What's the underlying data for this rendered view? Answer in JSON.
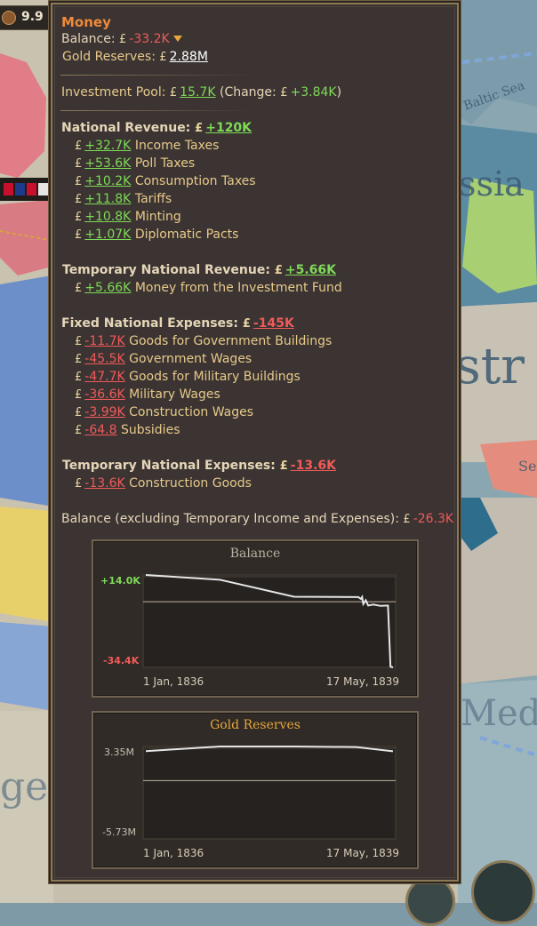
{
  "hud": {
    "value": "9.9"
  },
  "map_labels": {
    "sea": "Baltic Sea",
    "russia": "ssia",
    "austria": "str",
    "med": "Medi",
    "ser": "Se",
    "ger": "gel"
  },
  "tooltip": {
    "title": "Money",
    "balance": {
      "label": "Balance:",
      "value": "-33.2K"
    },
    "gold": {
      "label": "Gold Reserves:",
      "value": "2.88M"
    },
    "investment": {
      "label": "Investment Pool:",
      "value": "15.7K",
      "change_label": "(Change:",
      "change_value": "+3.84K",
      "close": ")"
    },
    "revenue": {
      "label": "National Revenue:",
      "value": "+120K",
      "items": [
        {
          "value": "+32.7K",
          "label": "Income Taxes"
        },
        {
          "value": "+53.6K",
          "label": "Poll Taxes"
        },
        {
          "value": "+10.2K",
          "label": "Consumption Taxes"
        },
        {
          "value": "+11.8K",
          "label": "Tariffs"
        },
        {
          "value": "+10.8K",
          "label": "Minting"
        },
        {
          "value": "+1.07K",
          "label": "Diplomatic Pacts"
        }
      ]
    },
    "temp_revenue": {
      "label": "Temporary National Revenue:",
      "value": "+5.66K",
      "items": [
        {
          "value": "+5.66K",
          "label": "Money from the Investment Fund"
        }
      ]
    },
    "fixed_expenses": {
      "label": "Fixed National Expenses:",
      "value": "-145K",
      "items": [
        {
          "value": "-11.7K",
          "label": "Goods for Government Buildings"
        },
        {
          "value": "-45.5K",
          "label": "Government Wages"
        },
        {
          "value": "-47.7K",
          "label": "Goods for Military Buildings"
        },
        {
          "value": "-36.6K",
          "label": "Military Wages"
        },
        {
          "value": "-3.99K",
          "label": "Construction Wages"
        },
        {
          "value": "-64.8",
          "label": "Subsidies"
        }
      ]
    },
    "temp_expenses": {
      "label": "Temporary National Expenses:",
      "value": "-13.6K",
      "items": [
        {
          "value": "-13.6K",
          "label": "Construction Goods"
        }
      ]
    },
    "balance_excl": {
      "label": "Balance (excluding Temporary Income and Expenses):",
      "value": "-26.3K"
    },
    "currency_symbol": "£"
  },
  "chart_data": [
    {
      "type": "line",
      "title": "Balance",
      "ylim": [
        -34.4,
        14.0
      ],
      "ytick_labels": [
        "+14.0K",
        "-34.4K"
      ],
      "xtick_labels": [
        "1 Jan, 1836",
        "17 May, 1839"
      ],
      "zero_line": true,
      "x": [
        0,
        0.3,
        0.6,
        0.86,
        0.87,
        0.875,
        0.88,
        0.89,
        0.9,
        0.92,
        0.95,
        0.98,
        0.99,
        1.0
      ],
      "values": [
        14.0,
        11.5,
        2.6,
        2.4,
        1.5,
        2.5,
        -1.2,
        0.8,
        -2.0,
        -1.5,
        -2.2,
        -2.0,
        -34.0,
        -34.4
      ],
      "colors": {
        "line": "#e6e6e6",
        "positive": "#7ed957",
        "negative": "#f05a5a"
      }
    },
    {
      "type": "line",
      "title": "Gold Reserves",
      "ylim": [
        -5.73,
        3.35
      ],
      "ytick_labels": [
        "3.35M",
        "-5.73M"
      ],
      "xtick_labels": [
        "1 Jan, 1836",
        "17 May, 1839"
      ],
      "zero_line": true,
      "x": [
        0,
        0.3,
        0.6,
        0.85,
        1.0
      ],
      "values": [
        2.9,
        3.35,
        3.35,
        3.3,
        2.88
      ],
      "colors": {
        "line": "#e6e6e6",
        "title": "#e8a53a"
      }
    }
  ]
}
